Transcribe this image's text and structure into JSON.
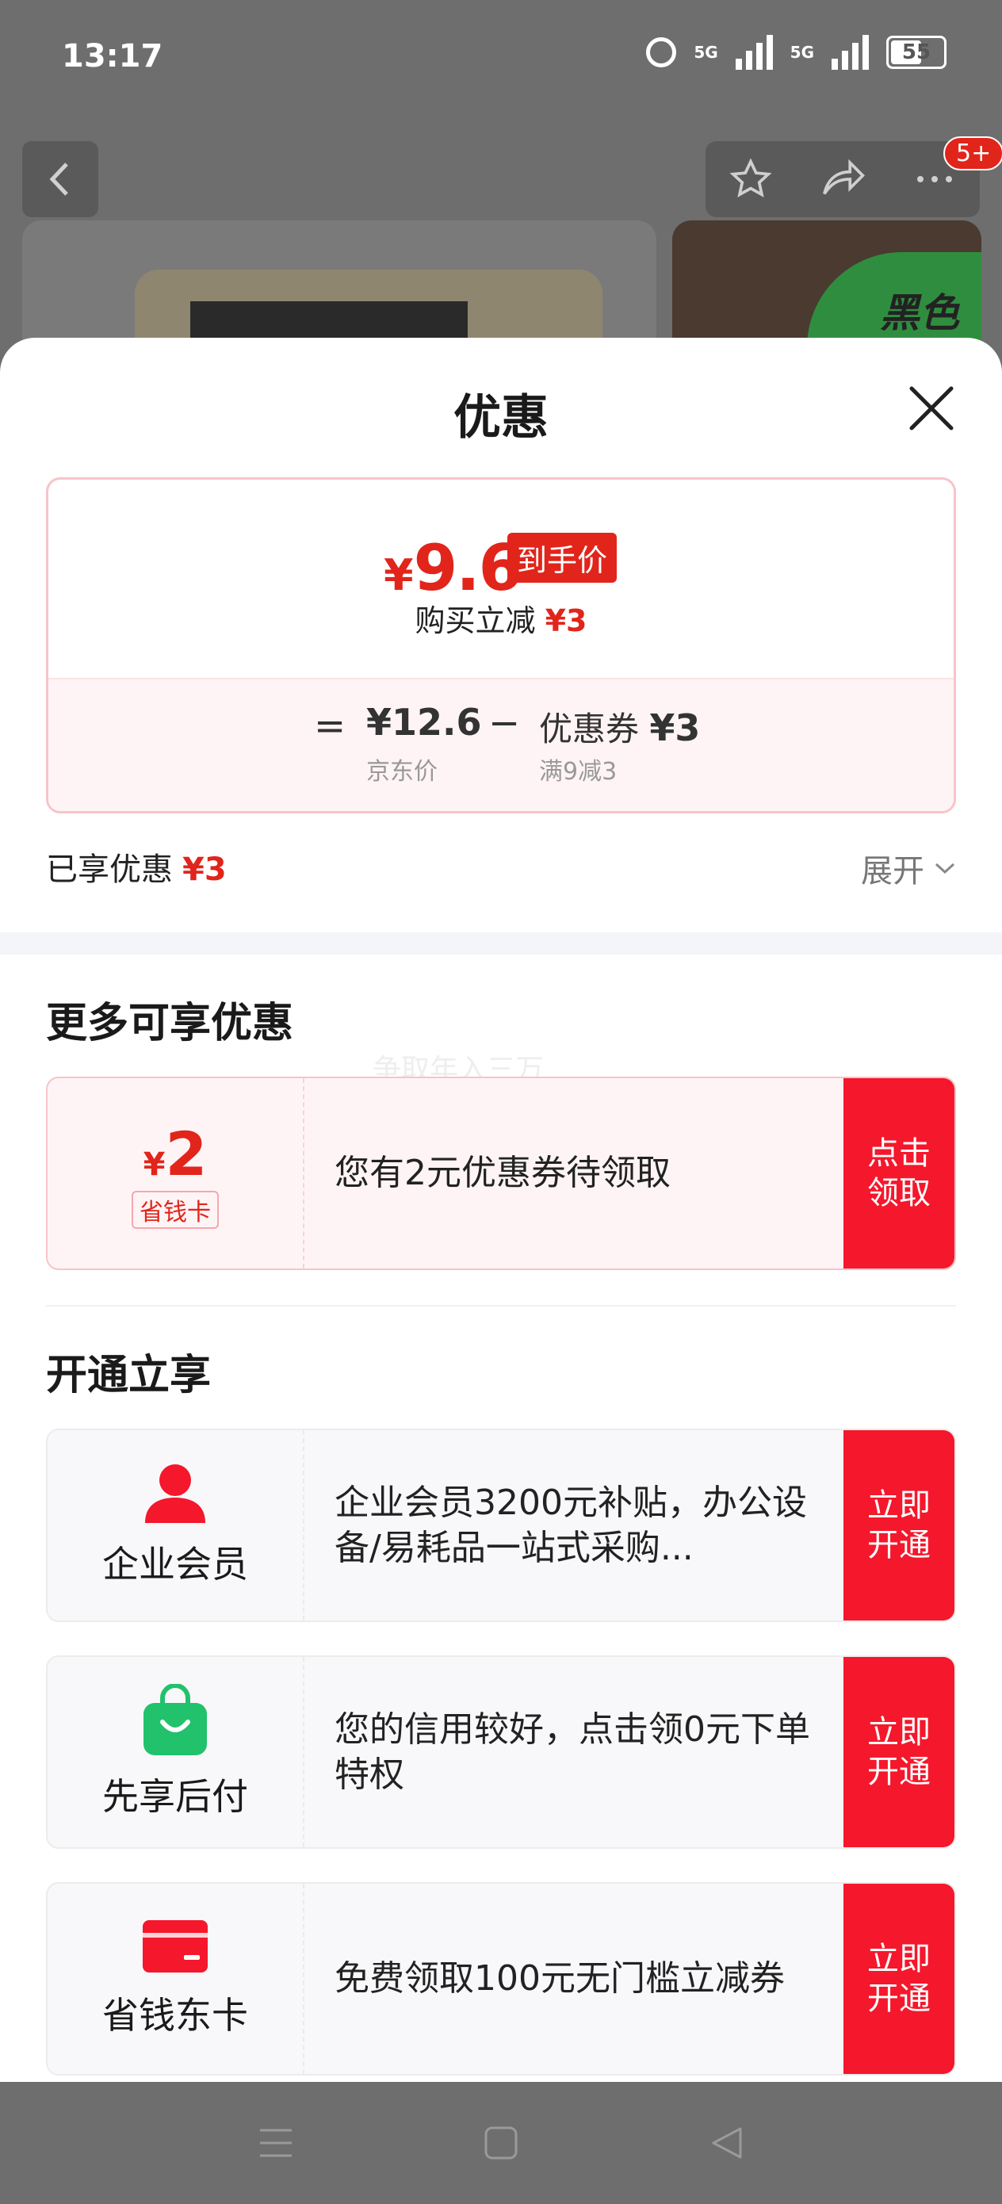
{
  "status_bar": {
    "time": "13:17",
    "network_1": "5G",
    "network_2": "5G",
    "battery": "55"
  },
  "background_page": {
    "cart_badge": "5+",
    "thumb_text": "黑色"
  },
  "sheet": {
    "title": "优惠",
    "price": {
      "currency": "¥",
      "final_price": "9.6",
      "final_tag": "到手价",
      "reduce_text": "购买立减",
      "reduce_amount": "¥3",
      "equals": "=",
      "jd_price": "¥12.6",
      "jd_price_label": "京东价",
      "minus": "−",
      "coupon_text": "优惠券",
      "coupon_amount": "¥3",
      "coupon_rule": "满9减3"
    },
    "enjoyed_label": "已享优惠",
    "enjoyed_amount": "¥3",
    "expand_label": "展开",
    "more_title": "更多可享优惠",
    "watermark": "争取年入三万",
    "saving_card": {
      "currency": "¥",
      "amount": "2",
      "tag": "省钱卡",
      "desc": "您有2元优惠券待领取",
      "button": "点击\n领取"
    },
    "open_title": "开通立享",
    "open_cards": [
      {
        "name": "企业会员",
        "icon": "person-icon",
        "desc": "企业会员3200元补贴，办公设备/易耗品一站式采购...",
        "button": "立即\n开通"
      },
      {
        "name": "先享后付",
        "icon": "shopping-bag-icon",
        "desc": "您的信用较好，点击领0元下单特权",
        "button": "立即\n开通"
      },
      {
        "name": "省钱东卡",
        "icon": "card-icon",
        "desc": "免费领取100元无门槛立减券",
        "button": "立即\n开通"
      }
    ]
  },
  "colors": {
    "accent_red": "#e1251b",
    "button_red": "#f5172c",
    "green_icon": "#21c26b"
  }
}
